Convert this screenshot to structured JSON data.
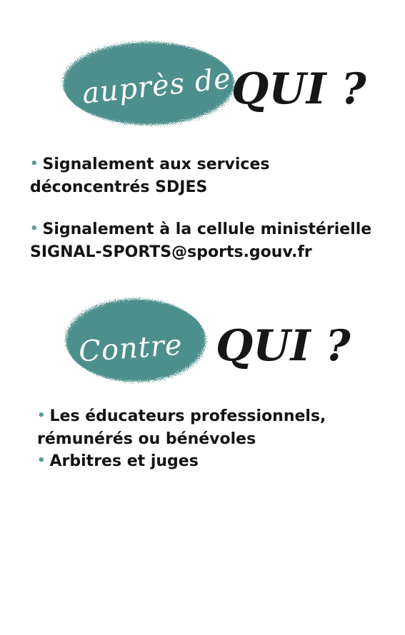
{
  "section1": {
    "script_label": "auprès de",
    "question": "QUI ?",
    "items": [
      {
        "line1": "Signalement aux services",
        "line2": "déconcentrés SDJES"
      },
      {
        "line1": "Signalement à la cellule ministérielle",
        "line2": "SIGNAL-SPORTS@sports.gouv.fr"
      }
    ]
  },
  "section2": {
    "script_label": "Contre",
    "question": "QUI ?",
    "items": [
      {
        "line1": "Les éducateurs professionnels,",
        "line2": "rémunérés ou bénévoles"
      },
      {
        "line1": "Arbitres et juges"
      }
    ]
  },
  "colors": {
    "teal_blob": "#4d8f8c",
    "bullet": "#5a9a96",
    "text": "#141414"
  },
  "icons": {
    "bullet": "bullet-dot-icon"
  }
}
